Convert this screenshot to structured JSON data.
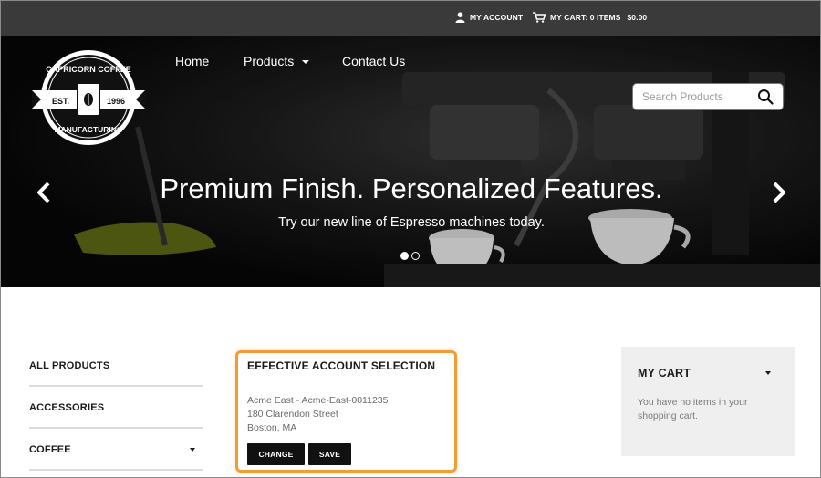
{
  "utility_bar": {
    "account_label": "MY ACCOUNT",
    "cart_label": "MY CART: 0 ITEMS",
    "cart_total": "$0.00"
  },
  "logo": {
    "top_text": "CAPRICORN COFFEE",
    "bottom_text": "MANUFACTURING",
    "est": "EST.",
    "year": "1996"
  },
  "nav": {
    "home": "Home",
    "products": "Products",
    "contact": "Contact Us"
  },
  "search": {
    "placeholder": "Search Products"
  },
  "hero": {
    "title": "Premium Finish. Personalized Features.",
    "subtitle": "Try our new line of Espresso machines today.",
    "slide_count": 2,
    "active_slide": 1
  },
  "sidebar": {
    "items": [
      {
        "label": "ALL PRODUCTS"
      },
      {
        "label": "ACCESSORIES"
      },
      {
        "label": "COFFEE"
      }
    ]
  },
  "account": {
    "title": "EFFECTIVE ACCOUNT SELECTION",
    "line1": "Acme East - Acme-East-0011235",
    "line2": "180 Clarendon Street",
    "line3": "Boston, MA",
    "change_label": "CHANGE",
    "save_label": "SAVE"
  },
  "cart": {
    "title": "MY CART",
    "message": "You have no items in your shopping cart."
  },
  "colors": {
    "utility_bar": "#3a3a3a",
    "highlight_border": "#f39c34",
    "button": "#111111",
    "cart_panel": "#efefef"
  }
}
